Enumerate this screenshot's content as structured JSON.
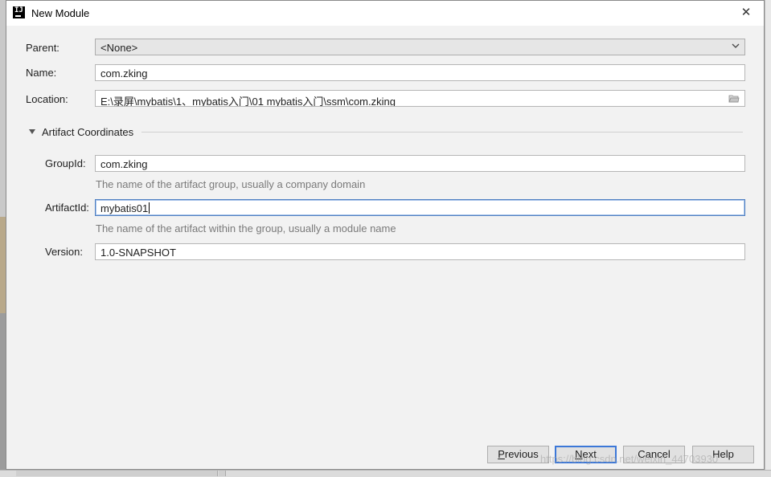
{
  "window": {
    "title": "New Module"
  },
  "form": {
    "parent": {
      "label": "Parent:",
      "value": "<None>"
    },
    "name": {
      "label": "Name:",
      "value": "com.zking"
    },
    "location": {
      "label": "Location:",
      "value": "E:\\录屏\\mybatis\\1、mybatis入门\\01 mybatis入门\\ssm\\com.zking"
    }
  },
  "artifact": {
    "section_title": "Artifact Coordinates",
    "group_id": {
      "label": "GroupId:",
      "value": "com.zking",
      "hint": "The name of the artifact group, usually a company domain"
    },
    "artifact_id": {
      "label": "ArtifactId:",
      "value": "mybatis01",
      "hint": "The name of the artifact within the group, usually a module name"
    },
    "version": {
      "label": "Version:",
      "value": "1.0-SNAPSHOT"
    }
  },
  "buttons": {
    "previous_mnemonic": "P",
    "previous_rest": "revious",
    "next_mnemonic": "N",
    "next_rest": "ext",
    "cancel": "Cancel",
    "help": "Help"
  },
  "watermark": "https://blog.csdn.net/weixin_44703930",
  "colors": {
    "accent": "#3c78d8",
    "dialog_bg": "#f2f2f2",
    "hint": "#7a7a7a"
  }
}
